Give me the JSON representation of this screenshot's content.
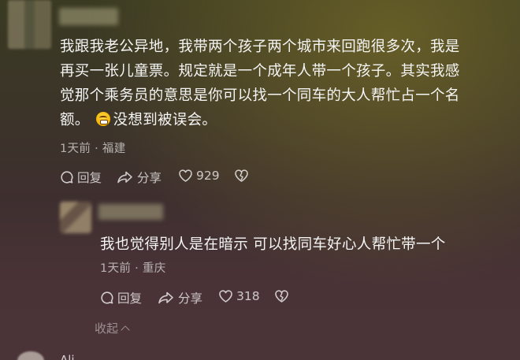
{
  "top_comment": {
    "text_lines": [
      "我跟我老公异地，我带两个孩子两个城市来回跑很多次，我是",
      "再买一张儿童票。规定就是一个成年人带一个孩子。其实我感",
      "觉那个乘务员的意思是你可以找一个同车的大人帮忙占一个名",
      "额。"
    ],
    "text_after_emoji": "没想到被误会。",
    "time": "1天前",
    "location": "福建",
    "reply_label": "回复",
    "share_label": "分享",
    "like_count": "929"
  },
  "reply_comment": {
    "text": "我也觉得别人是在暗示 可以找同车好心人帮忙带一个",
    "time": "1天前",
    "location": "重庆",
    "reply_label": "回复",
    "share_label": "分享",
    "like_count": "318"
  },
  "collapse_label": "收起",
  "next_comment": {
    "name_partial": "Ali"
  },
  "icons": {
    "emoji": "grimacing-face-emoji",
    "reply": "comment-bubble-icon",
    "share": "share-arrow-icon",
    "like": "heart-icon",
    "dislike": "broken-heart-icon"
  }
}
